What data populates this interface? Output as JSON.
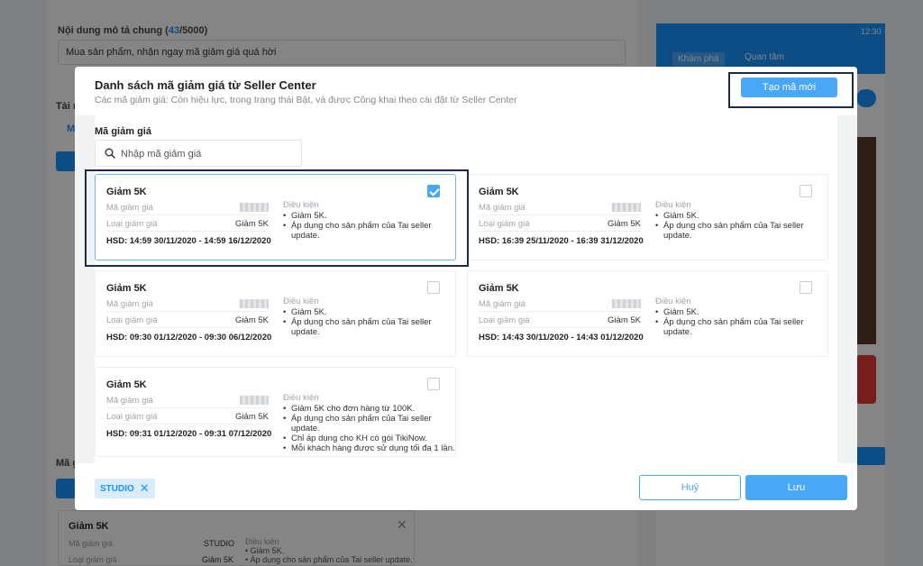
{
  "background": {
    "description_label": "Nội dung mô tả chung",
    "description_count": "43",
    "description_max": "5000",
    "description_text": "Mua sản phẩm, nhận ngay mã giảm giá quá hời",
    "side_label_1": "Tài n",
    "tab_label": "M",
    "side_label_2": "Mã g",
    "phone": {
      "tab_explore": "Khám phá",
      "tab_follow": "Quan tâm",
      "time": "12:30"
    },
    "voucher_preview": {
      "title": "Giảm 5K",
      "code_label": "Mã giảm giá",
      "code_value": "STUDIO",
      "type_label": "Loại giảm giá",
      "type_value": "Giảm 5K",
      "cond_title": "Điều kiện",
      "cond_1": "Giảm 5K.",
      "cond_2": "Áp dụng cho sản phẩm của Tai seller update."
    }
  },
  "modal": {
    "title": "Danh sách mã giảm giá từ Seller Center",
    "subtitle": "Các mã giảm giá: Còn hiệu lực, trong trạng thái Bật, và được Công khai theo cài đặt từ Seller Center",
    "create_button": "Tạo mã mới",
    "code_label": "Mã giảm giá",
    "search_placeholder": "Nhập mã giảm giá",
    "field_code": "Mã giảm giá",
    "field_type": "Loại giảm giá",
    "cond_title": "Điều kiện",
    "vouchers": [
      {
        "title": "Giảm 5K",
        "type_value": "Giảm 5K",
        "expiry": "HSD: 14:59 30/11/2020 - 14:59 16/12/2020",
        "checked": true,
        "conditions": [
          "Giảm 5K.",
          "Áp dụng cho sản phẩm của Tai seller update."
        ]
      },
      {
        "title": "Giảm 5K",
        "type_value": "Giảm 5K",
        "expiry": "HSD: 16:39 25/11/2020 - 16:39 31/12/2020",
        "checked": false,
        "conditions": [
          "Giảm 5K.",
          "Áp dụng cho sản phẩm của Tai seller update."
        ]
      },
      {
        "title": "Giảm 5K",
        "type_value": "Giảm 5K",
        "expiry": "HSD: 09:30 01/12/2020 - 09:30 06/12/2020",
        "checked": false,
        "conditions": [
          "Giảm 5K.",
          "Áp dụng cho sản phẩm của Tai seller update."
        ]
      },
      {
        "title": "Giảm 5K",
        "type_value": "Giảm 5K",
        "expiry": "HSD: 14:43 30/11/2020 - 14:43 01/12/2020",
        "checked": false,
        "conditions": [
          "Giảm 5K.",
          "Áp dụng cho sản phẩm của Tai seller update."
        ]
      },
      {
        "title": "Giảm 5K",
        "type_value": "Giảm 5K",
        "expiry": "HSD: 09:31 01/12/2020 - 09:31 07/12/2020",
        "checked": false,
        "conditions": [
          "Giảm 5K cho đơn hàng từ 100K.",
          "Áp dụng cho sản phẩm của Tai seller update.",
          "Chỉ áp dụng cho KH có gói TikiNow.",
          "Mỗi khách hàng được sử dụng tối đa 1 lần."
        ]
      }
    ],
    "selected_tag": "STUDIO",
    "cancel_button": "Huỷ",
    "save_button": "Lưu"
  }
}
